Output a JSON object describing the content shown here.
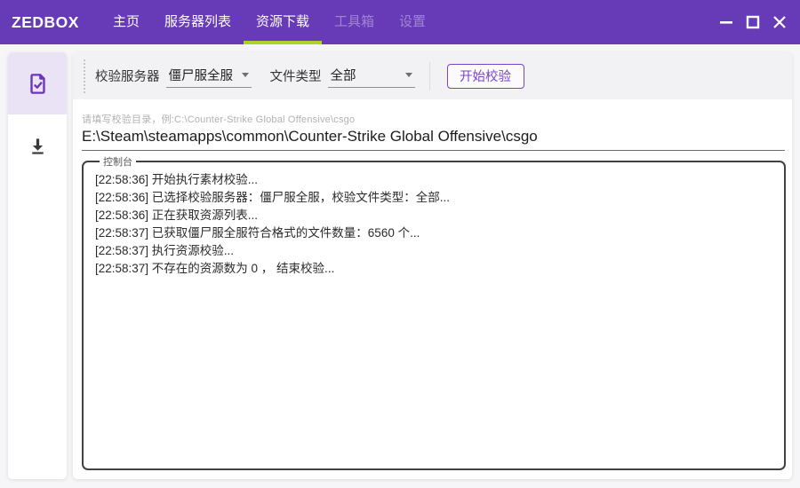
{
  "window": {
    "brand": "ZEDBOX",
    "tabs": [
      {
        "label": "主页",
        "state": "normal"
      },
      {
        "label": "服务器列表",
        "state": "normal"
      },
      {
        "label": "资源下载",
        "state": "active"
      },
      {
        "label": "工具箱",
        "state": "disabled"
      },
      {
        "label": "设置",
        "state": "disabled"
      }
    ],
    "controls": [
      "minimize-icon",
      "maximize-icon",
      "close-icon"
    ]
  },
  "sidebar": {
    "items": [
      {
        "icon": "file-check-icon",
        "active": true
      },
      {
        "icon": "download-icon",
        "active": false
      }
    ]
  },
  "toolbar": {
    "server_label": "校验服务器",
    "server_value": "僵尸服全服",
    "filetype_label": "文件类型",
    "filetype_value": "全部",
    "start_button": "开始校验"
  },
  "path_input": {
    "placeholder": "请填写校验目录，例:C:\\Counter-Strike Global Offensive\\csgo",
    "value": "E:\\Steam\\steamapps\\common\\Counter-Strike Global Offensive\\csgo"
  },
  "console": {
    "legend": "控制台",
    "lines": [
      "[22:58:36] 开始执行素材校验...",
      "[22:58:36] 已选择校验服务器：僵尸服全服，校验文件类型：全部...",
      "[22:58:36] 正在获取资源列表...",
      "[22:58:37] 已获取僵尸服全服符合格式的文件数量：6560 个...",
      "[22:58:37] 执行资源校验...",
      "[22:58:37] 不存在的资源数为 0 ， 结束校验..."
    ]
  },
  "colors": {
    "titlebar": "#673ab7",
    "accent": "#7a44c8",
    "tab_underline": "#a7d32b",
    "sidebar_active_bg": "#eae3f6"
  }
}
